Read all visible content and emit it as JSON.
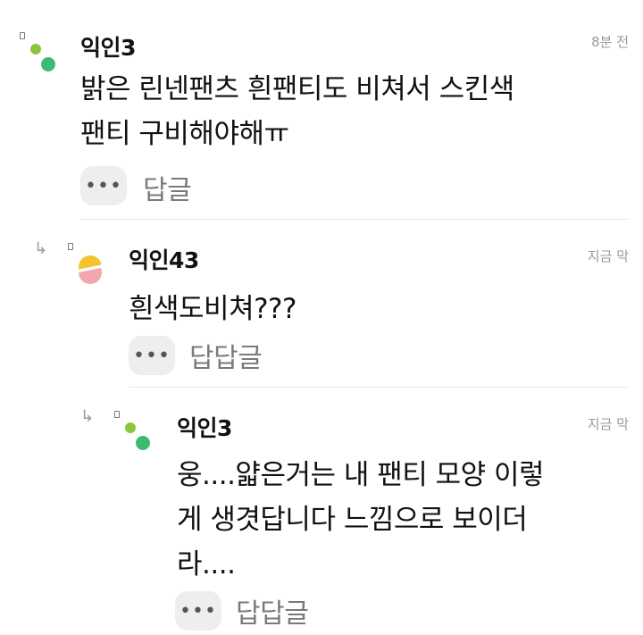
{
  "comments": [
    {
      "username": "익인3",
      "time": "8분 전",
      "lines": [
        "밝은 린넨팬츠 흰팬티도 비쳐서 스킨색",
        "팬티 구비해야해ㅠ"
      ],
      "reply_label": "답글",
      "more_label": "•••",
      "avatar_colors": [
        "#8cc63f",
        "#3dbb73"
      ]
    },
    {
      "username": "익인43",
      "time": "지금 막",
      "lines": [
        "흰색도비쳐???"
      ],
      "reply_label": "답답글",
      "more_label": "•••",
      "reply_arrow": "↳",
      "avatar_colors": [
        "#f4c430",
        "#f4a6b0"
      ]
    },
    {
      "username": "익인3",
      "time": "지금 막",
      "lines": [
        "웅....얇은거는 내 팬티 모양 이렇",
        "게 생겻답니다 느낌으로 보이더",
        "라...."
      ],
      "reply_label": "답답글",
      "more_label": "•••",
      "reply_arrow": "↳",
      "avatar_colors": [
        "#8cc63f",
        "#3dbb73"
      ]
    }
  ]
}
